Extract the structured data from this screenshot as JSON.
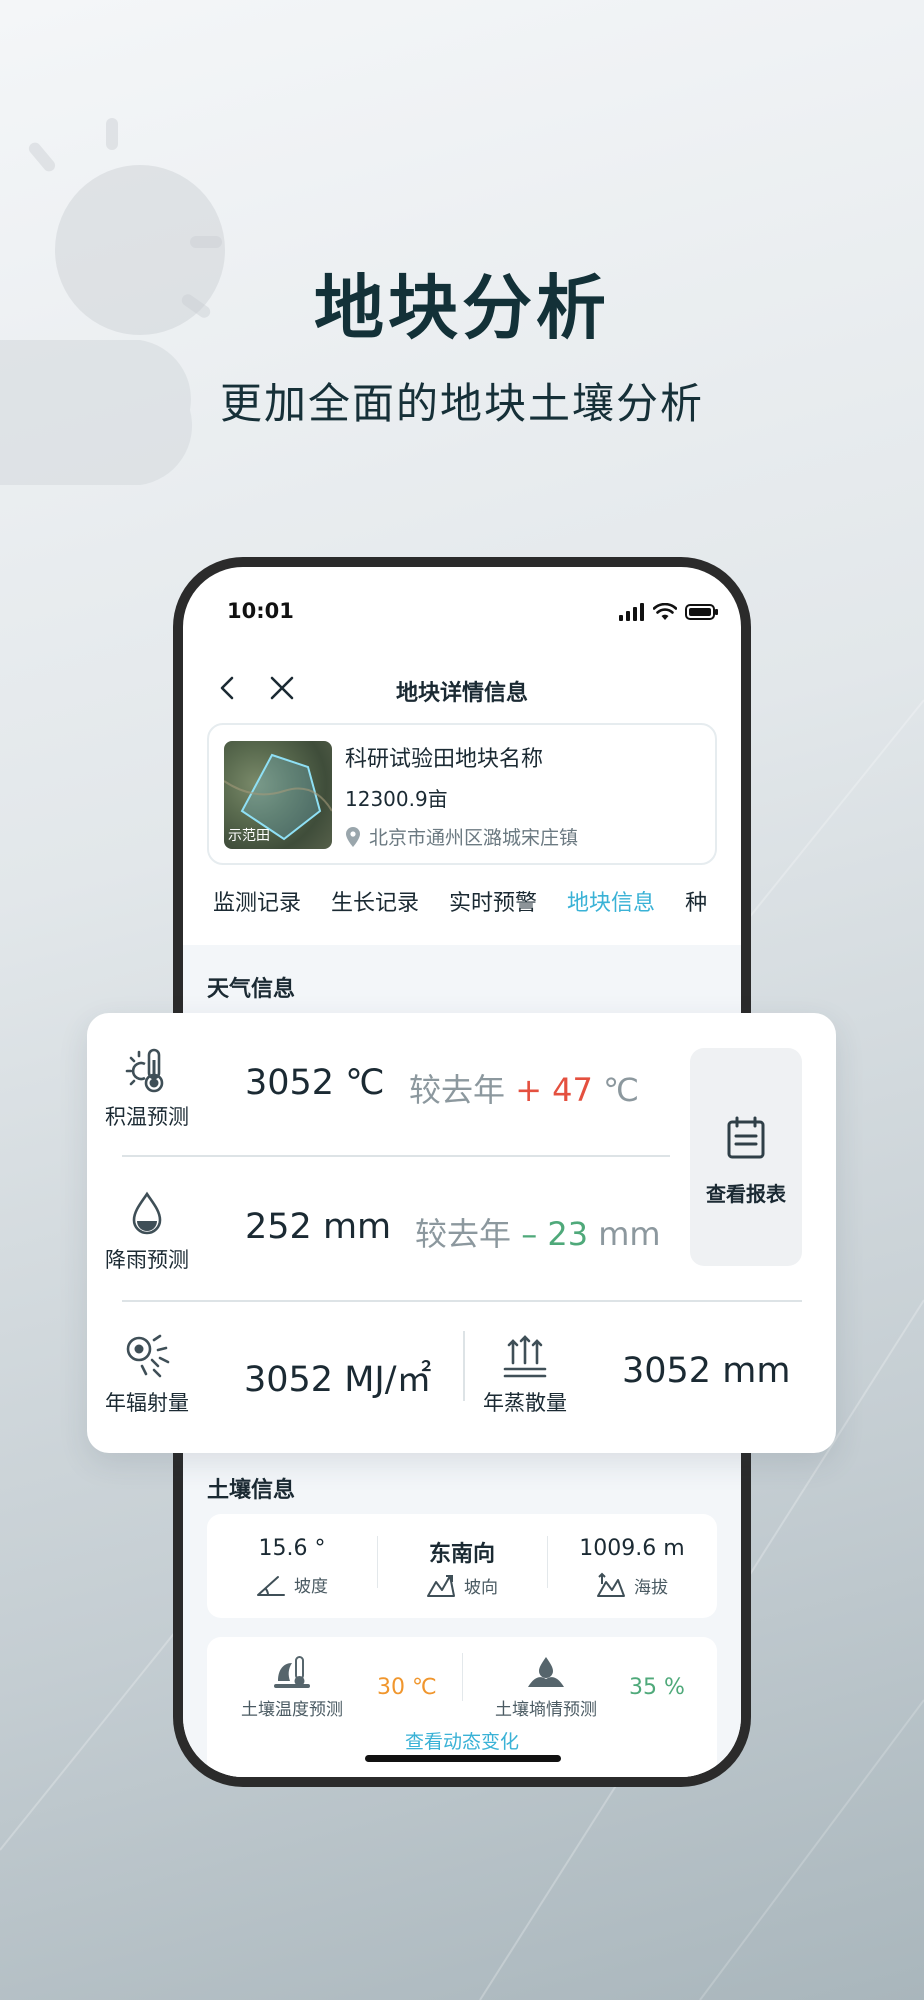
{
  "hero": {
    "title": "地块分析",
    "subtitle": "更加全面的地块土壤分析"
  },
  "status_bar": {
    "time": "10:01"
  },
  "nav": {
    "title": "地块详情信息"
  },
  "plot": {
    "name": "科研试验田地块名称",
    "area": "12300.9亩",
    "location": "北京市通州区潞城宋庄镇",
    "thumb_tag": "示范田"
  },
  "tabs": [
    {
      "label": "监测记录"
    },
    {
      "label": "生长记录"
    },
    {
      "label": "实时预警"
    },
    {
      "label": "地块信息",
      "active": true
    },
    {
      "label": "种"
    }
  ],
  "weather": {
    "section_title": "天气信息",
    "accum_temp": {
      "label": "积温预测",
      "value": "3052",
      "unit": "℃",
      "compare_label": "较去年",
      "delta_sign": "+",
      "delta_value": "47",
      "delta_unit": "℃"
    },
    "rain": {
      "label": "降雨预测",
      "value": "252",
      "unit": "mm",
      "compare_label": "较去年",
      "delta_sign": "–",
      "delta_value": "23",
      "delta_unit": "mm"
    },
    "radiation": {
      "label": "年辐射量",
      "value": "3052",
      "unit": "MJ/㎡"
    },
    "evaporation": {
      "label": "年蒸散量",
      "value": "3052",
      "unit": "mm"
    },
    "report_button": "查看报表"
  },
  "soil": {
    "section_title": "土壤信息",
    "slope": {
      "value": "15.6 °",
      "label": "坡度"
    },
    "aspect": {
      "value": "东南向",
      "label": "坡向"
    },
    "altitude": {
      "value": "1009.6 m",
      "label": "海拔"
    },
    "soil_temp": {
      "label": "土壤温度预测",
      "value": "30 ℃"
    },
    "soil_moisture": {
      "label": "土壤墒情预测",
      "value": "35 %"
    },
    "dynamic_link": "查看动态变化"
  },
  "colors": {
    "accent": "#3ab2d6",
    "increase": "#e4503f",
    "decrease": "#4fa97a",
    "soil_temp": "#f0962d",
    "soil_moisture": "#4fa97a"
  }
}
